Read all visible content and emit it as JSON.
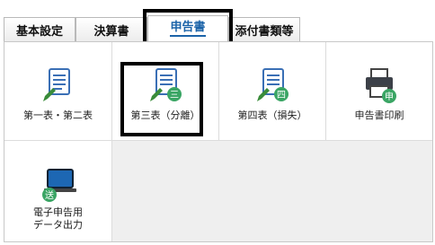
{
  "tabs": [
    {
      "label": "基本設定"
    },
    {
      "label": "決算書"
    },
    {
      "label": "申告書"
    },
    {
      "label": "添付書類等"
    }
  ],
  "tiles": [
    {
      "label": "第一表・第二表",
      "badge": ""
    },
    {
      "label": "第三表（分離）",
      "badge": "三"
    },
    {
      "label": "第四表（損失）",
      "badge": "四"
    },
    {
      "label": "申告書印刷",
      "badge": "申"
    },
    {
      "label_line1": "電子申告用",
      "label_line2": "データ出力",
      "badge": "送"
    }
  ],
  "colors": {
    "badge": "#3aa564",
    "tab_active_text": "#1b63a8",
    "doc_blue": "#3a6fb5",
    "pen_green": "#3a8c3a"
  }
}
